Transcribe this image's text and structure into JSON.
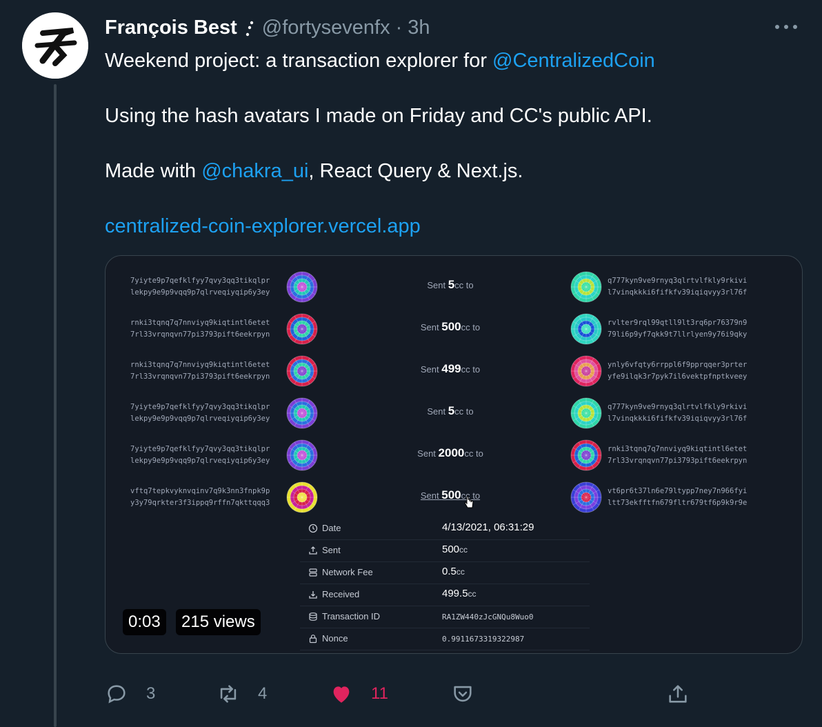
{
  "tweet": {
    "author_name": "François Best",
    "handle": "@fortysevenfx",
    "separator": "·",
    "time": "3h",
    "line1_text": "Weekend project: a transaction explorer for ",
    "line1_mention": "@CentralizedCoin",
    "line2_text": "Using the hash avatars I made on Friday and CC's public API.",
    "line3_pre": "Made with ",
    "line3_mention": "@chakra_ui",
    "line3_post": ", React Query & Next.js.",
    "link": "centralized-coin-explorer.vercel.app"
  },
  "media": {
    "transactions": [
      {
        "from1": "7yiyte9p7qefklfyy7qvy3qq3tikqlpr",
        "from2": "lekpy9e9p9vqq9p7qlrveqiyqip6y3ey",
        "sent_pre": "Sent ",
        "amount": "5",
        "sent_post": "cc to",
        "to1": "q777kyn9ve9rnyq3qlrtvlfkly9rkivi",
        "to2": "l7vinqkkki6fifkfv39iqiqvyy3rl76f",
        "from_colors": [
          "#7b3fd6",
          "#2a6fe0",
          "#23c9b5",
          "#c04fd8"
        ],
        "to_colors": [
          "#2fd6a8",
          "#2bd4c7",
          "#b8e23a",
          "#35e0a0"
        ]
      },
      {
        "from1": "rnki3tqnq7q7nnviyq9kiqtintl6etet",
        "from2": "7rl33vrqnqvn77pi3793pift6eekrpyn",
        "sent_pre": "Sent ",
        "amount": "500",
        "sent_post": "cc to",
        "to1": "rvlter9rql99qtll9lt3rq6pr76379n9",
        "to2": "79li6p9yf7qkk9t7llrlyen9y76i9qky",
        "from_colors": [
          "#d8204a",
          "#1e63d9",
          "#2fd6a8",
          "#7a3fd0"
        ],
        "to_colors": [
          "#2fd6c0",
          "#27c7c9",
          "#1b4fd8",
          "#3ae0c0"
        ]
      },
      {
        "from1": "rnki3tqnq7q7nnviyq9kiqtintl6etet",
        "from2": "7rl33vrqnqvn77pi3793pift6eekrpyn",
        "sent_pre": "Sent ",
        "amount": "499",
        "sent_post": "cc to",
        "to1": "ynly6vfqty6rrppl6f9pprqqer3prter",
        "to2": "yfe9ilqk3r7pyk7il6vektpfnptkveey",
        "from_colors": [
          "#d8204a",
          "#2a6fe0",
          "#2fd6a8",
          "#8040d0"
        ],
        "to_colors": [
          "#e0245e",
          "#e052a0",
          "#e8a050",
          "#c83a9a"
        ]
      },
      {
        "from1": "7yiyte9p7qefklfyy7qvy3qq3tikqlpr",
        "from2": "lekpy9e9p9vqq9p7qlrveqiyqip6y3ey",
        "sent_pre": "Sent ",
        "amount": "5",
        "sent_post": "cc to",
        "to1": "q777kyn9ve9rnyq3qlrtvlfkly9rkivi",
        "to2": "l7vinqkkki6fifkfv39iqiqvyy3rl76f",
        "from_colors": [
          "#7b3fd6",
          "#2a6fe0",
          "#23c9b5",
          "#c04fd8"
        ],
        "to_colors": [
          "#2fd6a8",
          "#2bd4c7",
          "#b8e23a",
          "#35e0a0"
        ]
      },
      {
        "from1": "7yiyte9p7qefklfyy7qvy3qq3tikqlpr",
        "from2": "lekpy9e9p9vqq9p7qlrveqiyqip6y3ey",
        "sent_pre": "Sent ",
        "amount": "2000",
        "sent_post": "cc to",
        "to1": "rnki3tqnq7q7nnviyq9kiqtintl6etet",
        "to2": "7rl33vrqnqvn77pi3793pift6eekrpyn",
        "from_colors": [
          "#7b3fd6",
          "#2a6fe0",
          "#23c9b5",
          "#c04fd8"
        ],
        "to_colors": [
          "#d8204a",
          "#1e63d9",
          "#2fd6a8",
          "#7a3fd0"
        ]
      },
      {
        "from1": "vftq7tepkvyknvqinv7q9k3nn3fnpk9p",
        "from2": "y3y79qrkter3f3ippq9rffn7qkttqqq3",
        "sent_pre": "Sent ",
        "amount": "500",
        "sent_post": "cc to",
        "to1": "vt6pr6t37ln6e79ltypp7ney7n966fyi",
        "to2": "ltt73ekfftfn679fltr679tf6p9k9r9e",
        "from_colors": [
          "#e8e030",
          "#c8209a",
          "#d8204a",
          "#f0e040"
        ],
        "to_colors": [
          "#3a3fd6",
          "#7a40e0",
          "#2a6fe0",
          "#d8204a"
        ]
      }
    ],
    "details": [
      {
        "icon": "clock-icon",
        "label": "Date",
        "value": "4/13/2021, 06:31:29",
        "unit": ""
      },
      {
        "icon": "upload-icon",
        "label": "Sent",
        "value": "500",
        "unit": "cc"
      },
      {
        "icon": "server-icon",
        "label": "Network Fee",
        "value": "0.5",
        "unit": "cc"
      },
      {
        "icon": "download-icon",
        "label": "Received",
        "value": "499.5",
        "unit": "cc"
      },
      {
        "icon": "database-icon",
        "label": "Transaction ID",
        "value": "RA1ZW440zJcGNQu8Wuo0",
        "unit": ""
      },
      {
        "icon": "lock-icon",
        "label": "Nonce",
        "value": "0.9911673319322987",
        "unit": ""
      }
    ],
    "timer": "0:03",
    "views": "215 views"
  },
  "actions": {
    "reply_count": "3",
    "retweet_count": "4",
    "like_count": "11",
    "colors": {
      "like": "#e0245e",
      "muted": "#8899a6",
      "link": "#1da1f2"
    }
  }
}
